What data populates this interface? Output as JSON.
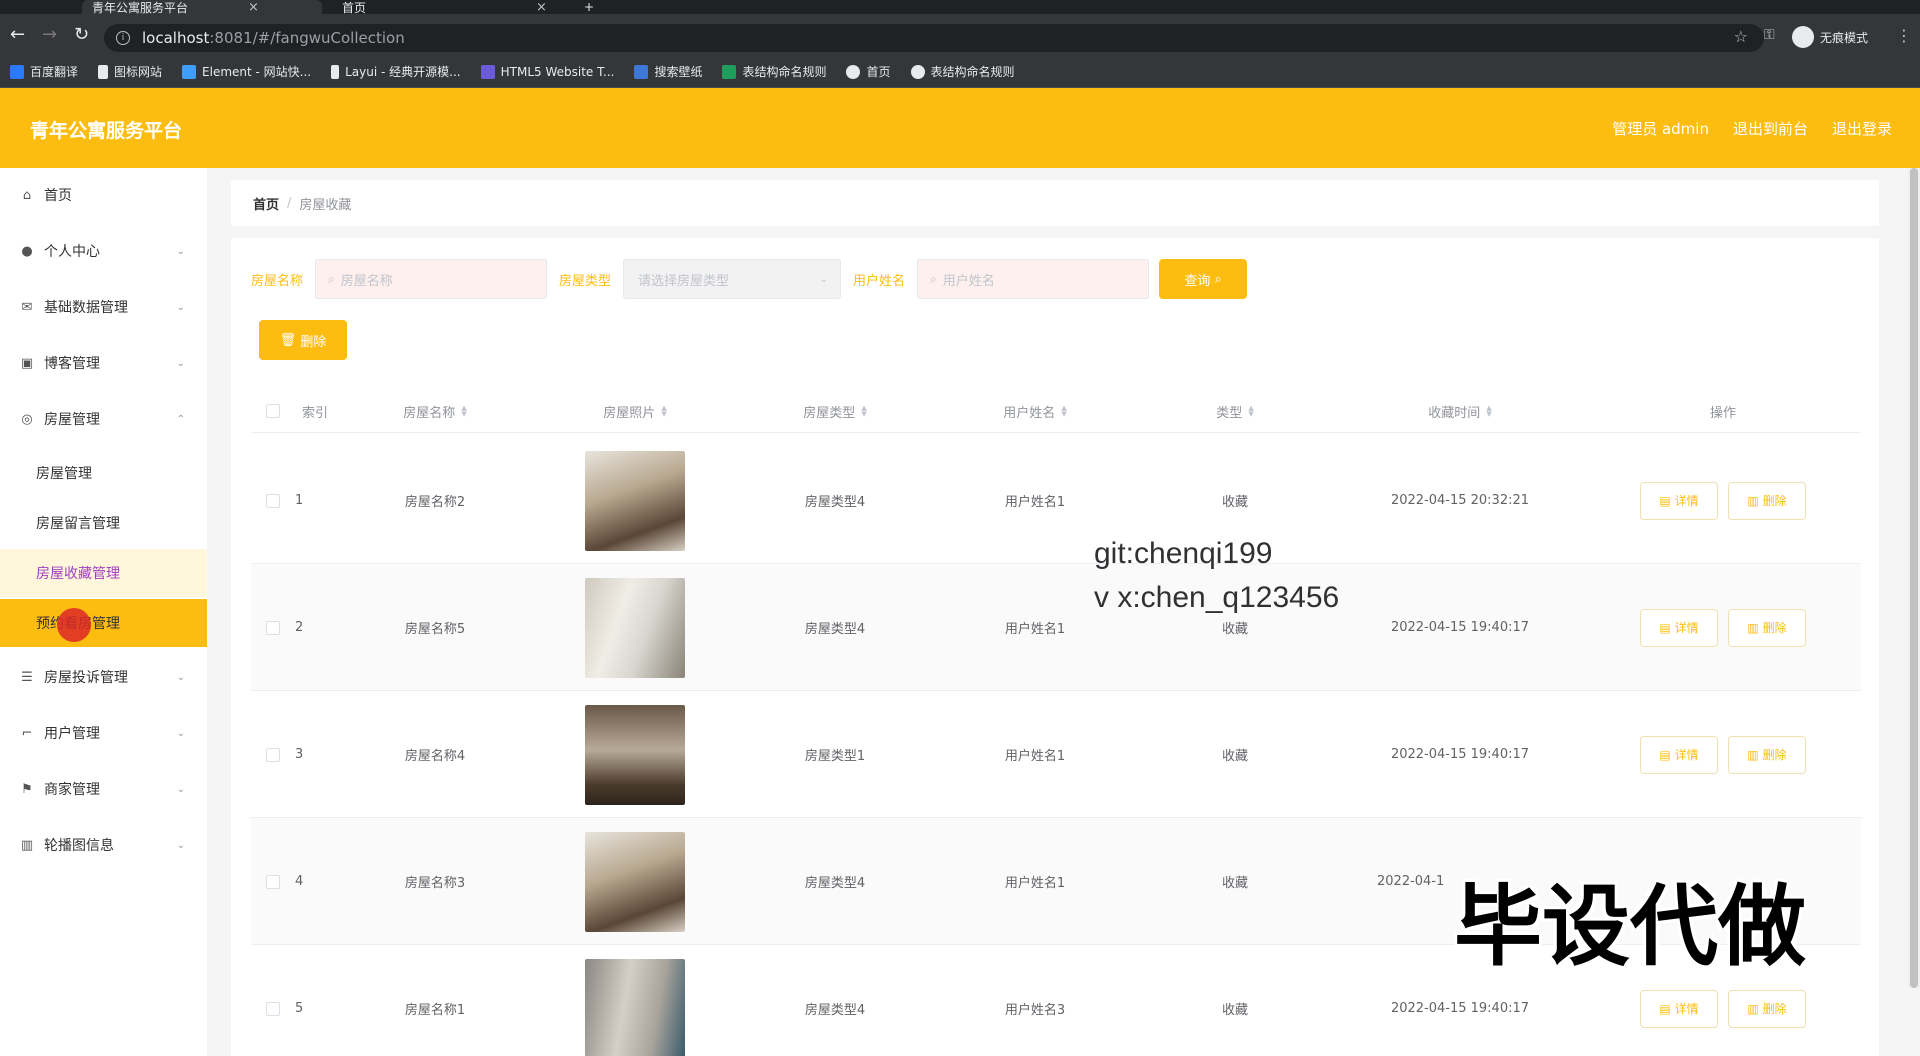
{
  "browser": {
    "tabs": [
      {
        "title": "青年公寓服务平台",
        "active": true
      },
      {
        "title": "首页",
        "active": false
      }
    ],
    "url_host": "localhost",
    "url_path": ":8081/#/fangwuCollection",
    "incognito_label": "无痕模式",
    "bookmarks": [
      "百度翻译",
      "图标网站",
      "Element - 网站快...",
      "Layui - 经典开源模...",
      "HTML5 Website T...",
      "搜索壁纸",
      "表结构命名规则",
      "首页",
      "表结构命名规则"
    ]
  },
  "app": {
    "title": "青年公寓服务平台",
    "header_links": [
      "管理员 admin",
      "退出到前台",
      "退出登录"
    ],
    "brand_color": "#fdbd10"
  },
  "sidebar": {
    "items": [
      {
        "label": "首页",
        "icon": "home-icon"
      },
      {
        "label": "个人中心",
        "icon": "user-icon"
      },
      {
        "label": "基础数据管理",
        "icon": "mail-icon"
      },
      {
        "label": "博客管理",
        "icon": "clipboard-icon"
      },
      {
        "label": "房屋管理",
        "icon": "compass-icon"
      }
    ],
    "subitems": [
      "房屋管理",
      "房屋留言管理",
      "房屋收藏管理",
      "预约看房管理"
    ],
    "items_after": [
      {
        "label": "房屋投诉管理",
        "icon": "sliders-icon"
      },
      {
        "label": "用户管理",
        "icon": "crop-icon"
      },
      {
        "label": "商家管理",
        "icon": "flag-icon"
      },
      {
        "label": "轮播图信息",
        "icon": "chart-icon"
      }
    ]
  },
  "breadcrumb": {
    "home": "首页",
    "separator": "/",
    "current": "房屋收藏"
  },
  "search": {
    "name_label": "房屋名称",
    "name_placeholder": "房屋名称",
    "type_label": "房屋类型",
    "type_placeholder": "请选择房屋类型",
    "user_label": "用户姓名",
    "user_placeholder": "用户姓名",
    "query_button": "查询",
    "delete_button": "删除"
  },
  "table": {
    "columns": [
      "索引",
      "房屋名称",
      "房屋照片",
      "房屋类型",
      "用户姓名",
      "类型",
      "收藏时间",
      "操作"
    ],
    "rows": [
      {
        "index": "1",
        "name": "房屋名称2",
        "type": "房屋类型4",
        "user": "用户姓名1",
        "kind": "收藏",
        "time": "2022-04-15 20:32:21"
      },
      {
        "index": "2",
        "name": "房屋名称5",
        "type": "房屋类型4",
        "user": "用户姓名1",
        "kind": "收藏",
        "time": "2022-04-15 19:40:17"
      },
      {
        "index": "3",
        "name": "房屋名称4",
        "type": "房屋类型1",
        "user": "用户姓名1",
        "kind": "收藏",
        "time": "2022-04-15 19:40:17"
      },
      {
        "index": "4",
        "name": "房屋名称3",
        "type": "房屋类型4",
        "user": "用户姓名1",
        "kind": "收藏",
        "time": "2022-04-1"
      },
      {
        "index": "5",
        "name": "房屋名称1",
        "type": "房屋类型4",
        "user": "用户姓名3",
        "kind": "收藏",
        "time": "2022-04-15 19:40:17"
      }
    ],
    "detail_button": "详情",
    "delete_button": "删除"
  },
  "overlay": {
    "watermark_line1": "git:chenqi199",
    "watermark_line2": "v x:chen_q123456",
    "big_text": "毕设代做"
  }
}
